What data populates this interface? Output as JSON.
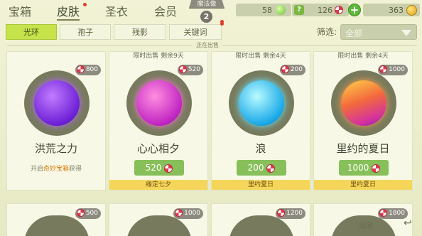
{
  "nav": {
    "items": [
      "宝箱",
      "皮肤",
      "圣衣",
      "会员"
    ],
    "active_index": 1
  },
  "badge": {
    "title": "魔法像",
    "level": "2"
  },
  "currencies": {
    "gems": "58",
    "candies": "126",
    "coins": "363"
  },
  "tabs": [
    "光环",
    "孢子",
    "残影",
    "关键词"
  ],
  "filter": {
    "label": "筛选:",
    "value": "全部"
  },
  "section_title": "正在出售",
  "cards": [
    {
      "limit": "",
      "price": "800",
      "name": "洪荒之力",
      "sub_prefix": "开启",
      "sub_highlight": "奇妙宝箱",
      "sub_suffix": "获得",
      "button": "",
      "tag": "",
      "colors": [
        "#c07bff",
        "#6d20d6"
      ]
    },
    {
      "limit": "限时出售 剩余9天",
      "price": "520",
      "name": "心心相夕",
      "button": "520",
      "tag": "缘定七夕",
      "colors": [
        "#ff8de0",
        "#c126c2"
      ]
    },
    {
      "limit": "限时出售 剩余4天",
      "price": "200",
      "name": "浪",
      "button": "200",
      "tag": "里约夏日",
      "colors": [
        "#7ff4ff",
        "#1aa9e8"
      ]
    },
    {
      "limit": "限时出售 剩余4天",
      "price": "1000",
      "name": "里约的夏日",
      "button": "1000",
      "tag": "里约夏日",
      "colors": [
        "#ffb84a",
        "#d5339d"
      ]
    }
  ],
  "bottom_prices": [
    "500",
    "1000",
    "1200",
    "1800"
  ],
  "back_label": "返回"
}
